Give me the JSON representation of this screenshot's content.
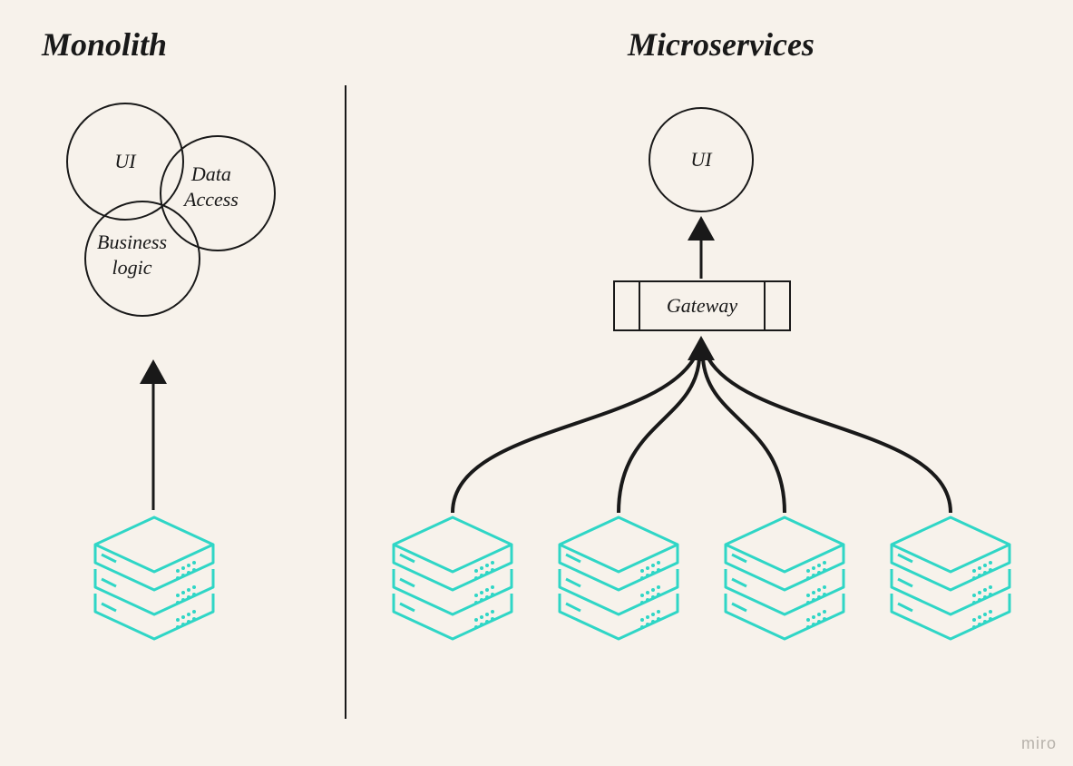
{
  "left": {
    "title": "Monolith",
    "circles": {
      "ui": "UI",
      "data_access": "Data\nAccess",
      "business_logic": "Business\nlogic"
    }
  },
  "right": {
    "title": "Microservices",
    "ui": "UI",
    "gateway": "Gateway",
    "service_count": 4
  },
  "icons": {
    "server_stack": "server-stack-icon"
  },
  "colors": {
    "stroke": "#191919",
    "accent": "#2fd6c6",
    "bg": "#f7f2eb"
  },
  "watermark": "miro"
}
